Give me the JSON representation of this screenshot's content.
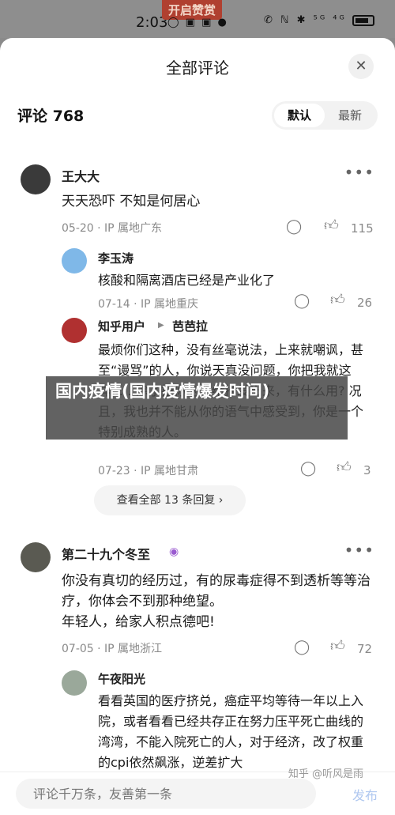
{
  "status_bar": {
    "time": "2:03",
    "app_tag": "开启赞赏",
    "sys_icons": "◯ ▣ ▣ ●",
    "right_icons": "✆ ℕ ✱ ⁵ᴳ ⁴ᴳ"
  },
  "sheet": {
    "title": "全部评论",
    "close_icon": "✕"
  },
  "comments_header": {
    "count_label": "评论 768",
    "sort_default": "默认",
    "sort_latest": "最新"
  },
  "comments": [
    {
      "author": "王大大",
      "text": "天天恐吓 不知是何居心",
      "meta": "05-20 · IP 属地广东",
      "likes": "115",
      "avatar_color": "#3a3a3a"
    },
    {
      "author": "第二十九个冬至",
      "text": "你没有真切的经历过，有的尿毒症得不到透析等等治疗，你体会不到那种绝望。\n年轻人，给家人积点德吧!",
      "meta": "07-05 · IP 属地浙江",
      "likes": "72",
      "avatar_color": "#5a5a52"
    }
  ],
  "replies": [
    {
      "author": "李玉涛",
      "text": "核酸和隔离酒店已经是产业化了",
      "meta": "07-14 · IP 属地重庆",
      "likes": "26",
      "avatar_color": "#7fb8e8"
    },
    {
      "author": "知乎用户",
      "reply_to": "芭芭拉",
      "text": "最烦你们这种，没有丝毫说法，上来就嘲讽，甚至“谩骂”的人，你说天真没问题，你把我就这样……除了把你的情绪抒发出来，有什么用? 况且，我也并不能从你的语气中感受到，你是一个特别成熟的人。",
      "meta": "07-23 · IP 属地甘肃",
      "likes": "3",
      "avatar_color": "#b03030"
    },
    {
      "author": "午夜阳光",
      "text": "看看英国的医疗挤兑，癌症平均等待一年以上入院，或者看看已经共存正在努力压平死亡曲线的湾湾，不能入院死亡的人，对于经济，改了权重的cpi依然飙涨，逆差扩大",
      "avatar_color": "#9aa89a"
    }
  ],
  "view_all_replies": "查看全部 13 条回复 ›",
  "bottom_bar": {
    "input_placeholder": "评论千万条，友善第一条",
    "send_label": "发布",
    "watermark": "知乎 @听风是雨"
  },
  "overlay_caption": "国内疫情(国内疫情爆发时间)"
}
